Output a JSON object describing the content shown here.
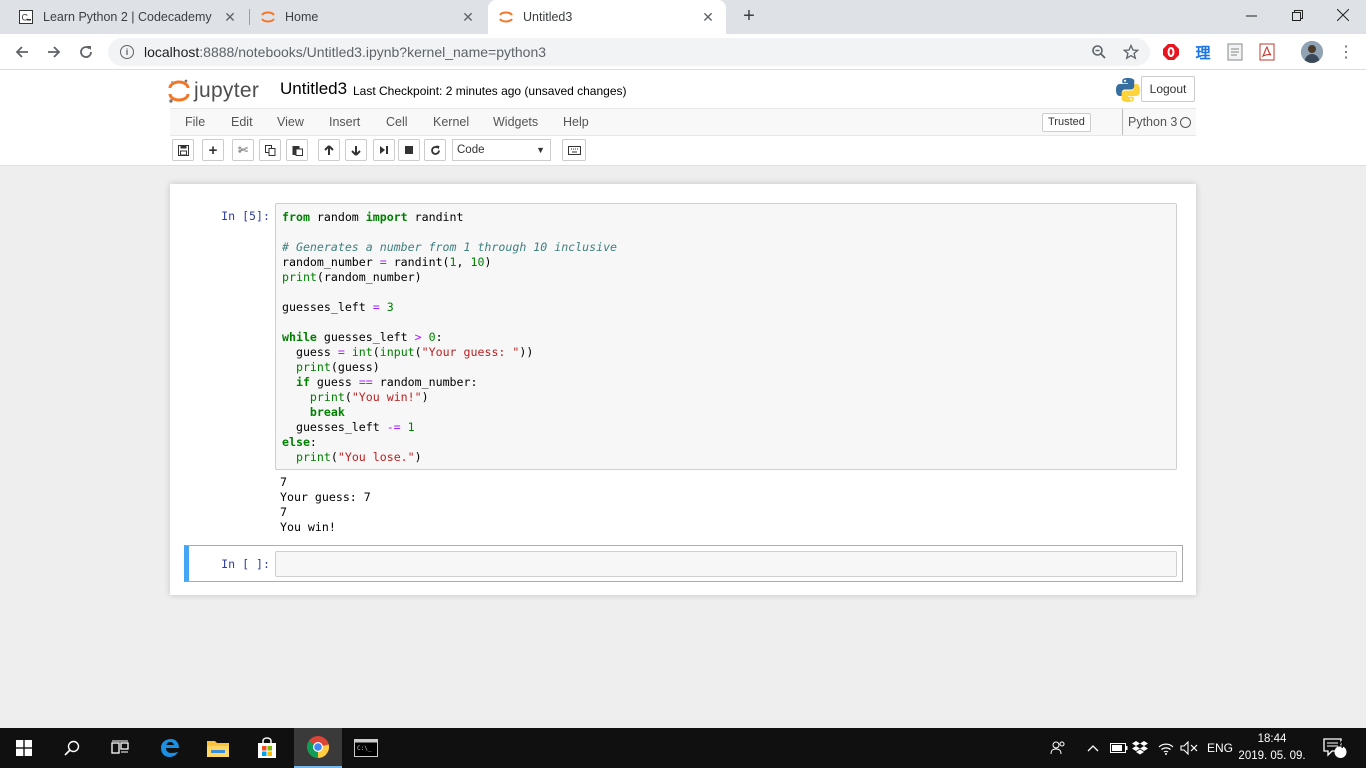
{
  "browser": {
    "tabs": [
      {
        "title": "Learn Python 2 | Codecademy",
        "favicon": "codecademy-icon",
        "active": false
      },
      {
        "title": "Home",
        "favicon": "jupyter-icon",
        "active": false
      },
      {
        "title": "Untitled3",
        "favicon": "jupyter-icon",
        "active": true
      }
    ],
    "url_host": "localhost",
    "url_rest": ":8888/notebooks/Untitled3.ipynb?kernel_name=python3",
    "extension_text": "理"
  },
  "jupyter": {
    "logo_text": "jupyter",
    "notebook_name": "Untitled3",
    "checkpoint": "Last Checkpoint: 2 minutes ago (unsaved changes)",
    "logout_label": "Logout",
    "menu": [
      "File",
      "Edit",
      "View",
      "Insert",
      "Cell",
      "Kernel",
      "Widgets",
      "Help"
    ],
    "trusted_label": "Trusted",
    "kernel_name": "Python 3",
    "cell_type": "Code"
  },
  "cells": {
    "cell1_prompt": "In [5]:",
    "cell1_output": [
      "7",
      "Your guess: 7",
      "7",
      "You win!"
    ],
    "cell2_prompt": "In [ ]:"
  },
  "taskbar": {
    "lang": "ENG",
    "time": "18:44",
    "date": "2019. 05. 09.",
    "notification_count": "4"
  }
}
